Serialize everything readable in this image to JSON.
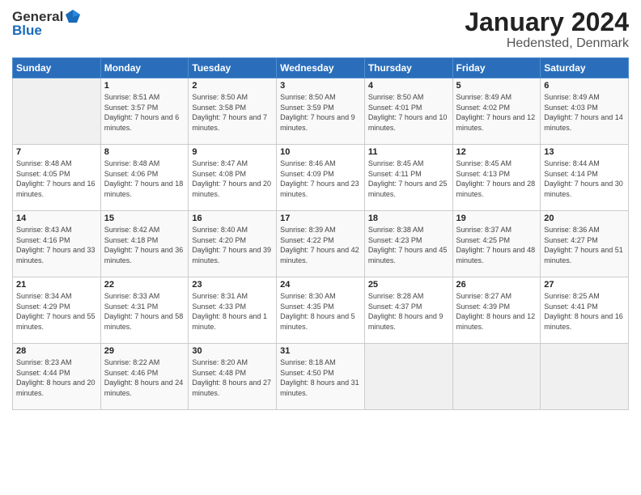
{
  "logo": {
    "general": "General",
    "blue": "Blue"
  },
  "header": {
    "title": "January 2024",
    "subtitle": "Hedensted, Denmark"
  },
  "days_of_week": [
    "Sunday",
    "Monday",
    "Tuesday",
    "Wednesday",
    "Thursday",
    "Friday",
    "Saturday"
  ],
  "weeks": [
    [
      {
        "day": "",
        "sunrise": "",
        "sunset": "",
        "daylight": ""
      },
      {
        "day": "1",
        "sunrise": "Sunrise: 8:51 AM",
        "sunset": "Sunset: 3:57 PM",
        "daylight": "Daylight: 7 hours and 6 minutes."
      },
      {
        "day": "2",
        "sunrise": "Sunrise: 8:50 AM",
        "sunset": "Sunset: 3:58 PM",
        "daylight": "Daylight: 7 hours and 7 minutes."
      },
      {
        "day": "3",
        "sunrise": "Sunrise: 8:50 AM",
        "sunset": "Sunset: 3:59 PM",
        "daylight": "Daylight: 7 hours and 9 minutes."
      },
      {
        "day": "4",
        "sunrise": "Sunrise: 8:50 AM",
        "sunset": "Sunset: 4:01 PM",
        "daylight": "Daylight: 7 hours and 10 minutes."
      },
      {
        "day": "5",
        "sunrise": "Sunrise: 8:49 AM",
        "sunset": "Sunset: 4:02 PM",
        "daylight": "Daylight: 7 hours and 12 minutes."
      },
      {
        "day": "6",
        "sunrise": "Sunrise: 8:49 AM",
        "sunset": "Sunset: 4:03 PM",
        "daylight": "Daylight: 7 hours and 14 minutes."
      }
    ],
    [
      {
        "day": "7",
        "sunrise": "Sunrise: 8:48 AM",
        "sunset": "Sunset: 4:05 PM",
        "daylight": "Daylight: 7 hours and 16 minutes."
      },
      {
        "day": "8",
        "sunrise": "Sunrise: 8:48 AM",
        "sunset": "Sunset: 4:06 PM",
        "daylight": "Daylight: 7 hours and 18 minutes."
      },
      {
        "day": "9",
        "sunrise": "Sunrise: 8:47 AM",
        "sunset": "Sunset: 4:08 PM",
        "daylight": "Daylight: 7 hours and 20 minutes."
      },
      {
        "day": "10",
        "sunrise": "Sunrise: 8:46 AM",
        "sunset": "Sunset: 4:09 PM",
        "daylight": "Daylight: 7 hours and 23 minutes."
      },
      {
        "day": "11",
        "sunrise": "Sunrise: 8:45 AM",
        "sunset": "Sunset: 4:11 PM",
        "daylight": "Daylight: 7 hours and 25 minutes."
      },
      {
        "day": "12",
        "sunrise": "Sunrise: 8:45 AM",
        "sunset": "Sunset: 4:13 PM",
        "daylight": "Daylight: 7 hours and 28 minutes."
      },
      {
        "day": "13",
        "sunrise": "Sunrise: 8:44 AM",
        "sunset": "Sunset: 4:14 PM",
        "daylight": "Daylight: 7 hours and 30 minutes."
      }
    ],
    [
      {
        "day": "14",
        "sunrise": "Sunrise: 8:43 AM",
        "sunset": "Sunset: 4:16 PM",
        "daylight": "Daylight: 7 hours and 33 minutes."
      },
      {
        "day": "15",
        "sunrise": "Sunrise: 8:42 AM",
        "sunset": "Sunset: 4:18 PM",
        "daylight": "Daylight: 7 hours and 36 minutes."
      },
      {
        "day": "16",
        "sunrise": "Sunrise: 8:40 AM",
        "sunset": "Sunset: 4:20 PM",
        "daylight": "Daylight: 7 hours and 39 minutes."
      },
      {
        "day": "17",
        "sunrise": "Sunrise: 8:39 AM",
        "sunset": "Sunset: 4:22 PM",
        "daylight": "Daylight: 7 hours and 42 minutes."
      },
      {
        "day": "18",
        "sunrise": "Sunrise: 8:38 AM",
        "sunset": "Sunset: 4:23 PM",
        "daylight": "Daylight: 7 hours and 45 minutes."
      },
      {
        "day": "19",
        "sunrise": "Sunrise: 8:37 AM",
        "sunset": "Sunset: 4:25 PM",
        "daylight": "Daylight: 7 hours and 48 minutes."
      },
      {
        "day": "20",
        "sunrise": "Sunrise: 8:36 AM",
        "sunset": "Sunset: 4:27 PM",
        "daylight": "Daylight: 7 hours and 51 minutes."
      }
    ],
    [
      {
        "day": "21",
        "sunrise": "Sunrise: 8:34 AM",
        "sunset": "Sunset: 4:29 PM",
        "daylight": "Daylight: 7 hours and 55 minutes."
      },
      {
        "day": "22",
        "sunrise": "Sunrise: 8:33 AM",
        "sunset": "Sunset: 4:31 PM",
        "daylight": "Daylight: 7 hours and 58 minutes."
      },
      {
        "day": "23",
        "sunrise": "Sunrise: 8:31 AM",
        "sunset": "Sunset: 4:33 PM",
        "daylight": "Daylight: 8 hours and 1 minute."
      },
      {
        "day": "24",
        "sunrise": "Sunrise: 8:30 AM",
        "sunset": "Sunset: 4:35 PM",
        "daylight": "Daylight: 8 hours and 5 minutes."
      },
      {
        "day": "25",
        "sunrise": "Sunrise: 8:28 AM",
        "sunset": "Sunset: 4:37 PM",
        "daylight": "Daylight: 8 hours and 9 minutes."
      },
      {
        "day": "26",
        "sunrise": "Sunrise: 8:27 AM",
        "sunset": "Sunset: 4:39 PM",
        "daylight": "Daylight: 8 hours and 12 minutes."
      },
      {
        "day": "27",
        "sunrise": "Sunrise: 8:25 AM",
        "sunset": "Sunset: 4:41 PM",
        "daylight": "Daylight: 8 hours and 16 minutes."
      }
    ],
    [
      {
        "day": "28",
        "sunrise": "Sunrise: 8:23 AM",
        "sunset": "Sunset: 4:44 PM",
        "daylight": "Daylight: 8 hours and 20 minutes."
      },
      {
        "day": "29",
        "sunrise": "Sunrise: 8:22 AM",
        "sunset": "Sunset: 4:46 PM",
        "daylight": "Daylight: 8 hours and 24 minutes."
      },
      {
        "day": "30",
        "sunrise": "Sunrise: 8:20 AM",
        "sunset": "Sunset: 4:48 PM",
        "daylight": "Daylight: 8 hours and 27 minutes."
      },
      {
        "day": "31",
        "sunrise": "Sunrise: 8:18 AM",
        "sunset": "Sunset: 4:50 PM",
        "daylight": "Daylight: 8 hours and 31 minutes."
      },
      {
        "day": "",
        "sunrise": "",
        "sunset": "",
        "daylight": ""
      },
      {
        "day": "",
        "sunrise": "",
        "sunset": "",
        "daylight": ""
      },
      {
        "day": "",
        "sunrise": "",
        "sunset": "",
        "daylight": ""
      }
    ]
  ]
}
